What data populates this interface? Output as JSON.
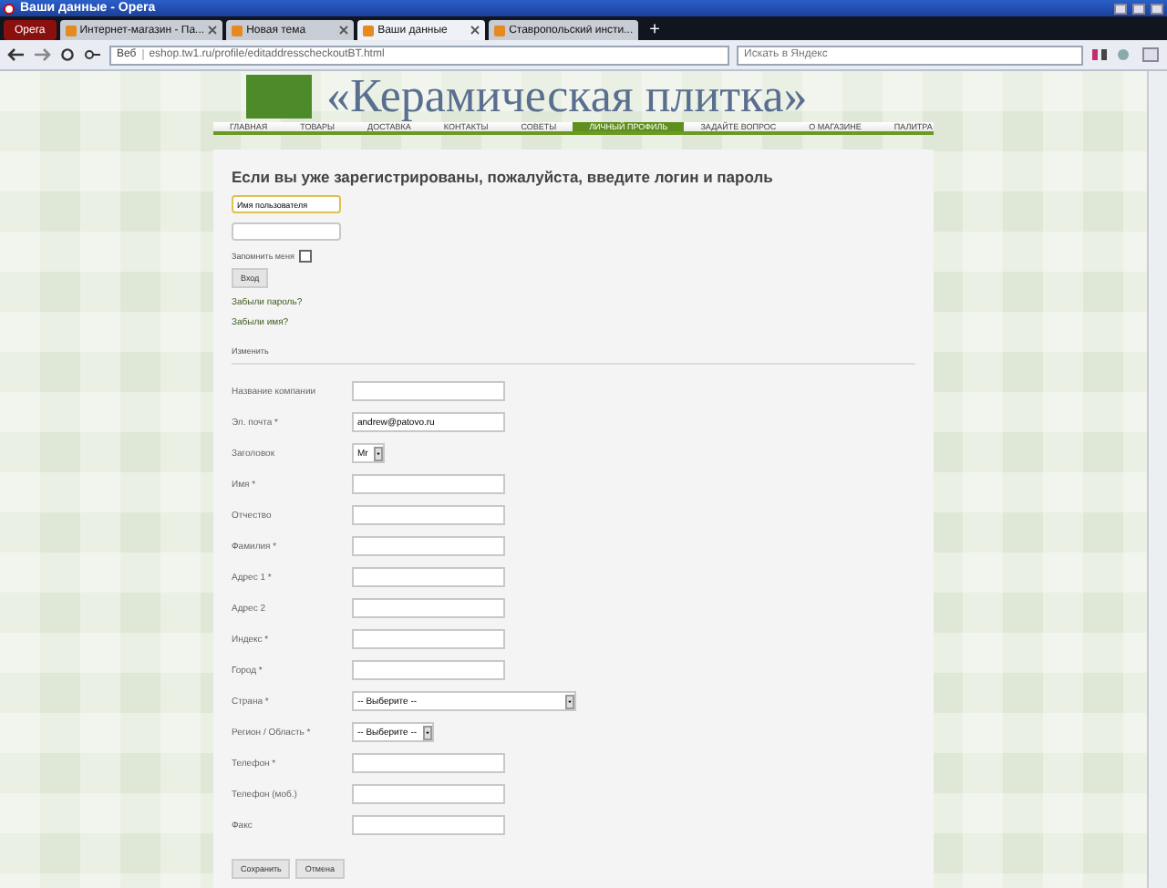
{
  "window": {
    "title": "Ваши данные - Opera"
  },
  "menu_button": "Opera",
  "tabs": [
    {
      "label": "Интернет-магазин - Па...",
      "selected": false,
      "closable": true
    },
    {
      "label": "Новая тема",
      "selected": false,
      "closable": true
    },
    {
      "label": "Ваши данные",
      "selected": true,
      "closable": true
    },
    {
      "label": "Ставропольский инсти...",
      "selected": false,
      "closable": false
    }
  ],
  "new_tab": "+",
  "address_bar": {
    "badge": "Веб",
    "url": "eshop.tw1.ru/profile/editaddresscheckoutBT.html"
  },
  "search": {
    "placeholder": "Искать в Яндекс"
  },
  "site": {
    "logo_text": "«Керамическая плитка»",
    "nav": [
      {
        "label": "ГЛАВНАЯ",
        "selected": false
      },
      {
        "label": "ТОВАРЫ",
        "selected": false
      },
      {
        "label": "ДОСТАВКА",
        "selected": false
      },
      {
        "label": "КОНТАКТЫ",
        "selected": false
      },
      {
        "label": "СОВЕТЫ",
        "selected": false
      },
      {
        "label": "ЛИЧНЫЙ ПРОФИЛЬ",
        "selected": true
      },
      {
        "label": "ЗАДАЙТЕ ВОПРОС",
        "selected": false
      },
      {
        "label": "О МАГАЗИНЕ",
        "selected": false
      },
      {
        "label": "ПАЛИТРА",
        "selected": false
      }
    ]
  },
  "login": {
    "heading": "Если вы уже зарегистрированы, пожалуйста, введите логин и пароль",
    "username": {
      "value": "Имя пользователя"
    },
    "remember": {
      "label": "Запомнить меня",
      "checked": false
    },
    "button": "Вход",
    "links": [
      "Забыли пароль?",
      "Забыли имя?"
    ]
  },
  "edit_section": "Изменить",
  "fields": [
    {
      "label": "Название компании",
      "kind": "input"
    },
    {
      "label": "Эл. почта *",
      "kind": "input",
      "value": "andrew@patovo.ru"
    },
    {
      "label": "Заголовок",
      "kind": "select",
      "value": "Mr"
    },
    {
      "label": "Имя *",
      "kind": "input"
    },
    {
      "label": "Отчество",
      "kind": "input"
    },
    {
      "label": "Фамилия *",
      "kind": "input"
    },
    {
      "label": "Адрес 1 *",
      "kind": "input"
    },
    {
      "label": "Адрес 2",
      "kind": "input"
    },
    {
      "label": "Индекс *",
      "kind": "input"
    },
    {
      "label": "Город *",
      "kind": "input"
    },
    {
      "label": "Страна *",
      "kind": "wide-select",
      "value": "-- Выберите --"
    },
    {
      "label": "Регион / Область *",
      "kind": "select",
      "value": "-- Выберите --"
    },
    {
      "label": "Телефон *",
      "kind": "input"
    },
    {
      "label": "Телефон (моб.)",
      "kind": "input"
    },
    {
      "label": "Факс",
      "kind": "input"
    }
  ],
  "buttons": [
    "Сохранить",
    "Отмена"
  ]
}
